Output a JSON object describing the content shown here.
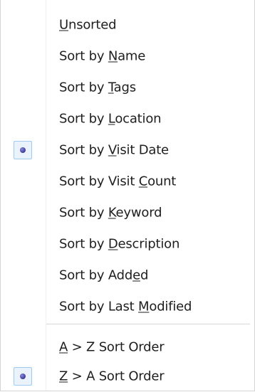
{
  "menu": {
    "items": [
      {
        "before": "",
        "key": "U",
        "after": "nsorted",
        "checked": false
      },
      {
        "before": "Sort by ",
        "key": "N",
        "after": "ame",
        "checked": false
      },
      {
        "before": "Sort by ",
        "key": "T",
        "after": "ags",
        "checked": false
      },
      {
        "before": "Sort by ",
        "key": "L",
        "after": "ocation",
        "checked": false
      },
      {
        "before": "Sort by ",
        "key": "V",
        "after": "isit Date",
        "checked": true
      },
      {
        "before": "Sort by Visit ",
        "key": "C",
        "after": "ount",
        "checked": false
      },
      {
        "before": "Sort by ",
        "key": "K",
        "after": "eyword",
        "checked": false
      },
      {
        "before": "Sort by ",
        "key": "D",
        "after": "escription",
        "checked": false
      },
      {
        "before": "Sort by Add",
        "key": "e",
        "after": "d",
        "checked": false
      },
      {
        "before": "Sort by Last ",
        "key": "M",
        "after": "odified",
        "checked": false
      }
    ],
    "order_items": [
      {
        "before": "",
        "key": "A",
        "after": " > Z Sort Order",
        "checked": false
      },
      {
        "before": "",
        "key": "Z",
        "after": " > A Sort Order",
        "checked": true
      }
    ]
  }
}
